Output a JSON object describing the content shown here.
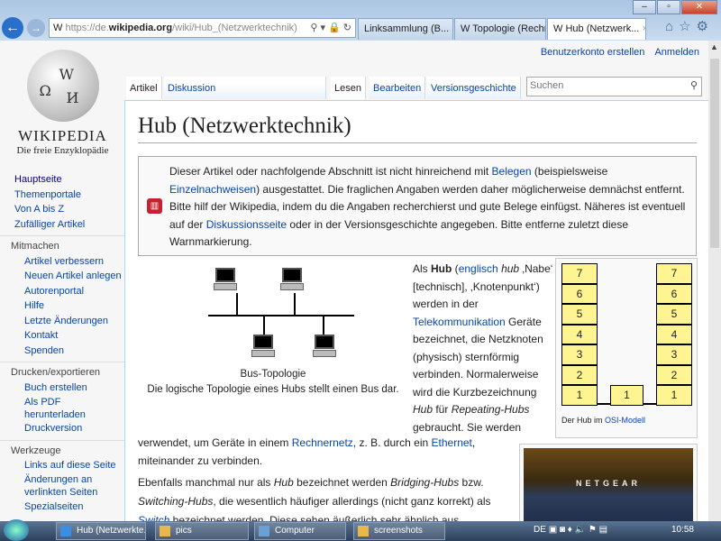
{
  "browser": {
    "url_prefix": "https://de.",
    "url_domain": "wikipedia.org",
    "url_path": "/wiki/Hub_(Netzwerktechnik)",
    "tabs": [
      {
        "label": "Linksammlung (B..."
      },
      {
        "label": "Topologie (Rechn..."
      },
      {
        "label": "Hub (Netzwerk..."
      }
    ]
  },
  "personal": {
    "create": "Benutzerkonto erstellen",
    "login": "Anmelden"
  },
  "logo": {
    "wordmark": "WIKIPEDIA",
    "tagline": "Die freie Enzyklopädie"
  },
  "page_tabs": {
    "article": "Artikel",
    "discussion": "Diskussion",
    "read": "Lesen",
    "edit": "Bearbeiten",
    "history": "Versionsgeschichte"
  },
  "search": {
    "placeholder": "Suchen"
  },
  "sidebar": {
    "main": [
      "Hauptseite",
      "Themenportale",
      "Von A bis Z",
      "Zufälliger Artikel"
    ],
    "sections": [
      {
        "title": "Mitmachen",
        "items": [
          "Artikel verbessern",
          "Neuen Artikel anlegen",
          "Autorenportal",
          "Hilfe",
          "Letzte Änderungen",
          "Kontakt",
          "Spenden"
        ]
      },
      {
        "title": "Drucken/exportieren",
        "items": [
          "Buch erstellen",
          "Als PDF herunterladen",
          "Druckversion"
        ]
      },
      {
        "title": "Werkzeuge",
        "items": [
          "Links auf diese Seite",
          "Änderungen an verlinkten Seiten",
          "Spezialseiten"
        ]
      }
    ]
  },
  "article": {
    "title": "Hub (Netzwerktechnik)",
    "warning": {
      "t1": "Dieser Artikel oder nachfolgende Abschnitt ist nicht hinreichend mit ",
      "l1": "Belegen",
      "t2": " (beispielsweise ",
      "l2": "Einzelnachweisen",
      "t3": ") ausgestattet. Die fraglichen Angaben werden daher möglicherweise demnächst entfernt. Bitte hilf der Wikipedia, indem du die Angaben recherchierst und gute Belege einfügst. Näheres ist eventuell auf der ",
      "l3": "Diskussionsseite",
      "t4": " oder in der Versionsgeschichte angegeben. Bitte entferne zuletzt diese Warnmarkierung."
    },
    "bus_caption_title": "Bus-Topologie",
    "bus_caption": "Die logische Topologie eines Hubs stellt einen Bus dar.",
    "p1": {
      "a": "Als ",
      "b": "Hub",
      "c": " (",
      "l1": "englisch",
      "d": " ",
      "e": "hub",
      "f": " ‚Nabe‘ [technisch], ‚Knotenpunkt‘) werden in der ",
      "l2": "Telekommunikation",
      "g": " Geräte bezeichnet, die Netzknoten (physisch) sternförmig verbinden. Normalerweise wird die Kurzbezeichnung ",
      "h": "Hub",
      "i": " für ",
      "j": "Repeating-Hubs",
      "k": " gebraucht. Sie werden"
    },
    "p2": {
      "a": "verwendet, um Geräte in einem ",
      "l1": "Rechnernetz",
      "b": ", z. B. durch ein ",
      "l2": "Ethernet",
      "c": ", miteinander zu verbinden."
    },
    "p3": {
      "a": "Ebenfalls manchmal nur als ",
      "b": "Hub",
      "c": " bezeichnet werden ",
      "d": "Bridging-Hubs",
      "e": " bzw. ",
      "f": "Switching-Hubs",
      "g": ", die wesentlich häufiger allerdings (nicht ganz korrekt) als ",
      "l1": "Switch",
      "h": " bezeichnet werden. Diese sehen äußerlich sehr ähnlich aus"
    },
    "osi": {
      "layers": [
        "7",
        "6",
        "5",
        "4",
        "3",
        "2",
        "1"
      ],
      "hub_layer": "1",
      "caption": "Der Hub im ",
      "caption_link": "OSI-Modell"
    },
    "photo_text": "NETGEAR"
  },
  "taskbar": {
    "items": [
      "Hub (Netzwerkte...",
      "pics",
      "Computer",
      "screenshots"
    ],
    "lang": "DE",
    "time": "10:58"
  }
}
